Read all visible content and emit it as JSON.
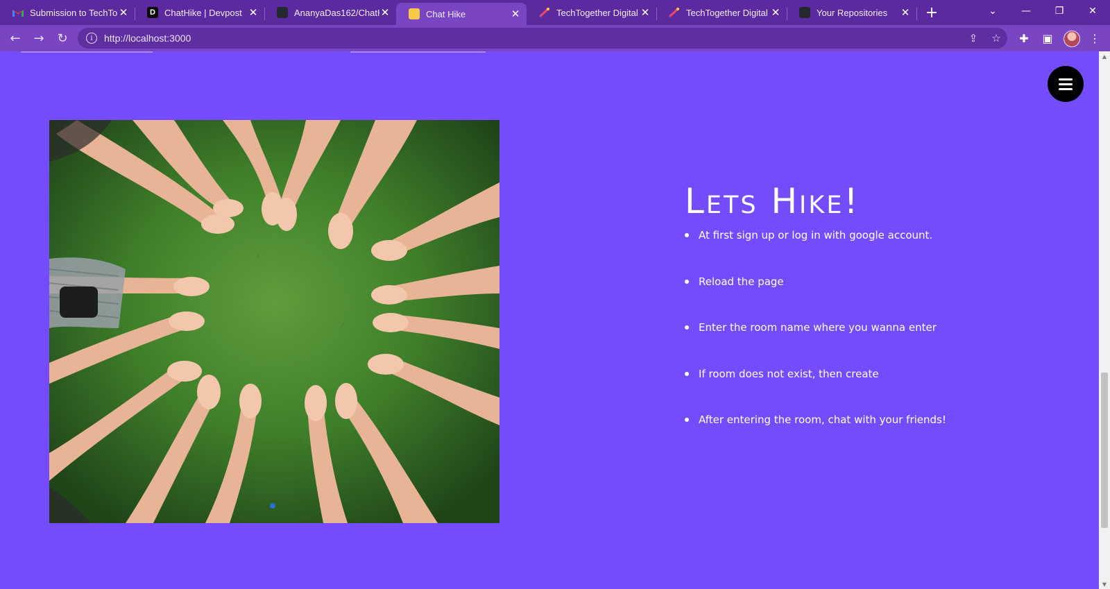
{
  "browser": {
    "tabs": [
      {
        "title": "Submission to TechTo",
        "favicon": "gmail-icon",
        "active": false
      },
      {
        "title": "ChatHike | Devpost",
        "favicon": "devpost-icon",
        "active": false
      },
      {
        "title": "AnanyaDas162/ChatH",
        "favicon": "github-icon",
        "active": false
      },
      {
        "title": "Chat Hike",
        "favicon": "chat-hike-icon",
        "active": true
      },
      {
        "title": "TechTogether Digital |",
        "favicon": "techtogether-icon",
        "active": false
      },
      {
        "title": "TechTogether Digital |",
        "favicon": "techtogether-icon",
        "active": false
      },
      {
        "title": "Your Repositories",
        "favicon": "github-icon",
        "active": false
      }
    ],
    "address": {
      "url": "http://localhost:3000"
    },
    "colors": {
      "tabstrip": "#5b2a9e",
      "toolbar": "#7a45c2"
    }
  },
  "page": {
    "background": "#744cfb",
    "headline": "Lets Hike!",
    "steps": [
      "At first sign up or log in with google account.",
      "Reload the page",
      "Enter the room name where you wanna enter",
      "If room does not exist, then create",
      "After entering the room, chat with your friends!"
    ],
    "image_subject": "circle of hands and feet on grass"
  }
}
